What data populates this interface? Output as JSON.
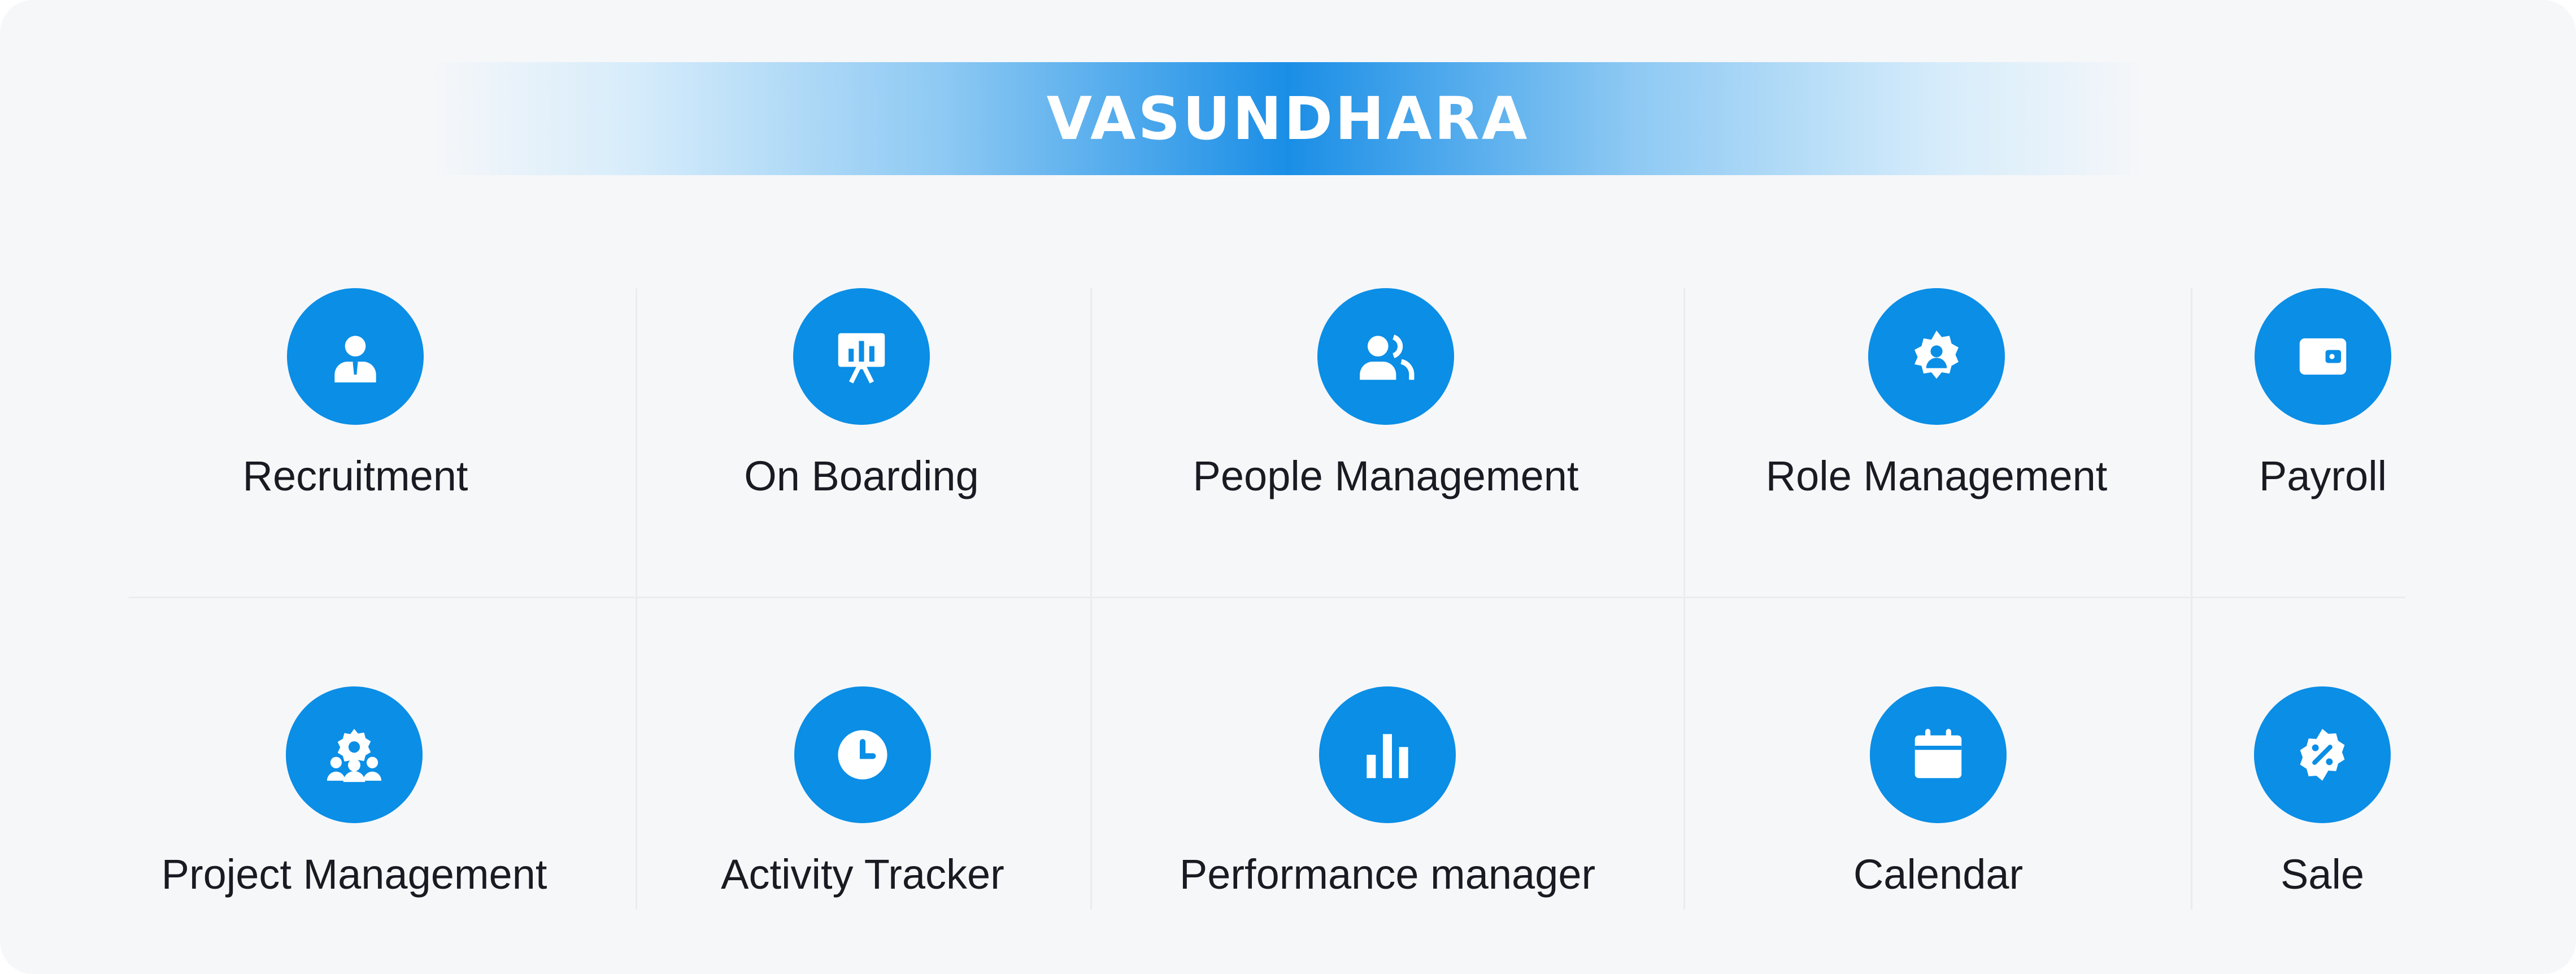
{
  "brand": {
    "logo_text": "VASUNDHARA"
  },
  "modules": [
    {
      "label": "Recruitment",
      "icon": "user-badge-icon"
    },
    {
      "label": "On Boarding",
      "icon": "presentation-board-icon"
    },
    {
      "label": "People Management",
      "icon": "people-icon"
    },
    {
      "label": "Role Management",
      "icon": "user-gear-icon"
    },
    {
      "label": "Payroll",
      "icon": "wallet-icon"
    },
    {
      "label": "Project Management",
      "icon": "team-gear-icon"
    },
    {
      "label": "Activity Tracker",
      "icon": "clock-icon"
    },
    {
      "label": "Performance manager",
      "icon": "bar-chart-icon"
    },
    {
      "label": "Calendar",
      "icon": "calendar-icon"
    },
    {
      "label": "Sale",
      "icon": "discount-badge-icon"
    }
  ],
  "colors": {
    "accent": "#0a8ee6",
    "text": "#1a1a22",
    "panel": "#f6f7f9"
  }
}
